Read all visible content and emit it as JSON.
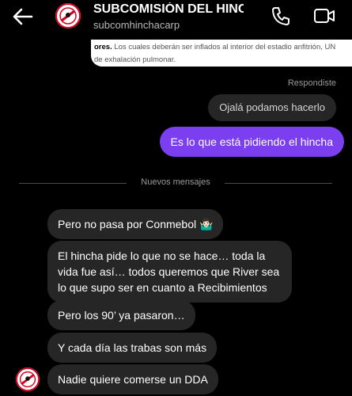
{
  "header": {
    "title": "SUBCOMISIÓN DEL HINCHA",
    "username": "subcomhinchacarp"
  },
  "quoted_message": {
    "bold_prefix": "ores.",
    "line1": " Los cuales deberán ser inflados al interior del estadio anfitrión, UN",
    "line2": "de exhalación pulmonar."
  },
  "reply_label": "Respondiste",
  "replied_to": "Ojalá podamos hacerlo",
  "sent_message": "Es lo que está pidiendo el hincha",
  "new_messages_label": "Nuevos mensajes",
  "received_messages": [
    "Pero no pasa por Conmebol 🤷🏻‍♂️",
    "El hincha pide lo que no se hace… toda la vida fue así… todos queremos que River sea lo que supo ser en cuanto a Recibimientos",
    "Pero los 90’ ya pasaron…",
    "Y cada día las trabas son más",
    "Nadie quiere comerse un DDA"
  ],
  "colors": {
    "background": "#000000",
    "sent_bubble": "#7B3FF0",
    "received_bubble": "#262626",
    "brand_red": "#d6001c"
  },
  "icons": {
    "back": "back-arrow-icon",
    "call": "phone-icon",
    "video": "video-camera-icon"
  }
}
